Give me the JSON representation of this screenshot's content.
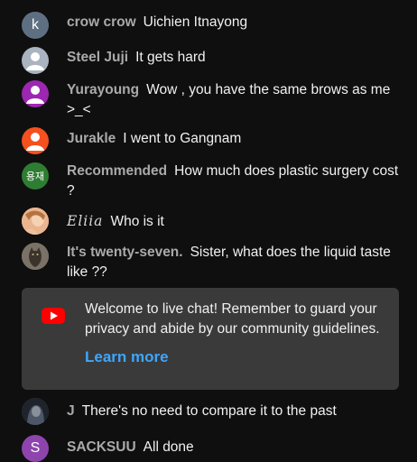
{
  "messages": [
    {
      "author": "crow crow",
      "text": "Uichien Itnayong",
      "avatar_letter": "k",
      "avatar_color": "#5f6f82"
    },
    {
      "author": "Steel Juji",
      "text": "It gets hard",
      "avatar_color": "#aab4c0"
    },
    {
      "author": "Yurayoung",
      "text": "Wow , you have the same brows as me >_<",
      "avatar_color": "#9c27b0"
    },
    {
      "author": "Jurakle",
      "text": "I went to Gangnam",
      "avatar_color": "#f4511e"
    },
    {
      "author": "Recommended",
      "text": "How much does plastic surgery cost ?",
      "avatar_letter": "용재",
      "avatar_color": "#2e7d32"
    },
    {
      "author": "Eliia",
      "text": "Who is it",
      "avatar_color": "#e8b48e"
    },
    {
      "author": "It's twenty-seven.",
      "text": "Sister, what does the liquid taste like ??",
      "avatar_color": "#6b6458"
    },
    {
      "author": "J",
      "text": "There's no need to compare it to the past",
      "avatar_color": "#3c4654"
    },
    {
      "author": "SACKSUU",
      "text": "All done",
      "avatar_letter": "S",
      "avatar_color": "#8e44ad"
    }
  ],
  "banner": {
    "text": "Welcome to live chat! Remember to guard your privacy and abide by our community guidelines.",
    "link": "Learn more",
    "icon": "youtube-icon",
    "icon_color": "#ff0000",
    "link_color": "#3ea6ff"
  }
}
